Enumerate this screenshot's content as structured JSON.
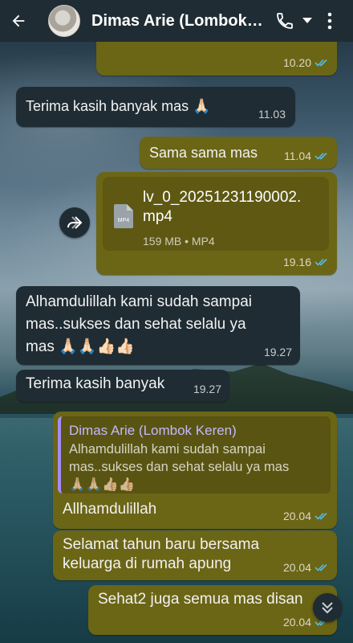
{
  "header": {
    "contact_name": "Dimas Arie (Lombok Keren)",
    "icons": [
      "back-arrow-icon",
      "avatar",
      "phone-icon",
      "dropdown-caret-icon",
      "more-vert-icon"
    ]
  },
  "messages": [
    {
      "dir": "out",
      "text": "",
      "time": "10.20",
      "ticks": "read"
    },
    {
      "dir": "in",
      "text": "Terima kasih banyak mas 🙏🏻",
      "time": "11.03"
    },
    {
      "dir": "out",
      "text": "Sama sama mas",
      "time": "11.04",
      "ticks": "read"
    },
    {
      "dir": "out",
      "type": "file",
      "file_name": "lv_0_20251231190002.\nmp4",
      "file_badge": "MP4",
      "file_meta": "159 MB • MP4",
      "time": "19.16",
      "ticks": "read"
    },
    {
      "dir": "in",
      "text": "Alhamdulillah kami sudah sampai\nmas..sukses dan sehat selalu ya\nmas 🙏🏻🙏🏻👍🏻👍🏻",
      "time": "19.27"
    },
    {
      "dir": "in",
      "text": "Terima kasih banyak",
      "time": "19.27"
    },
    {
      "dir": "out",
      "type": "reply",
      "quote_author": "Dimas Arie (Lombok Keren)",
      "quote_text": "Alhamdulillah kami sudah sampai\nmas..sukses dan sehat selalu ya mas\n🙏🏻🙏🏻👍🏻👍🏻",
      "text": "Allhamdulillah",
      "time": "20.04",
      "ticks": "read"
    },
    {
      "dir": "out",
      "text": "Selamat tahun baru bersama\nkeluarga di rumah apung",
      "time": "20.04",
      "ticks": "read"
    },
    {
      "dir": "out",
      "text": "Sehat2 juga semua mas disan",
      "time": "20.04",
      "ticks": "read"
    }
  ],
  "colors": {
    "header_bg": "#1f2c34",
    "incoming_bubble": "#1f2c33",
    "outgoing_bubble": "#6b6516",
    "read_ticks": "#53bdeb",
    "quote_bar": "#a78bfa"
  }
}
